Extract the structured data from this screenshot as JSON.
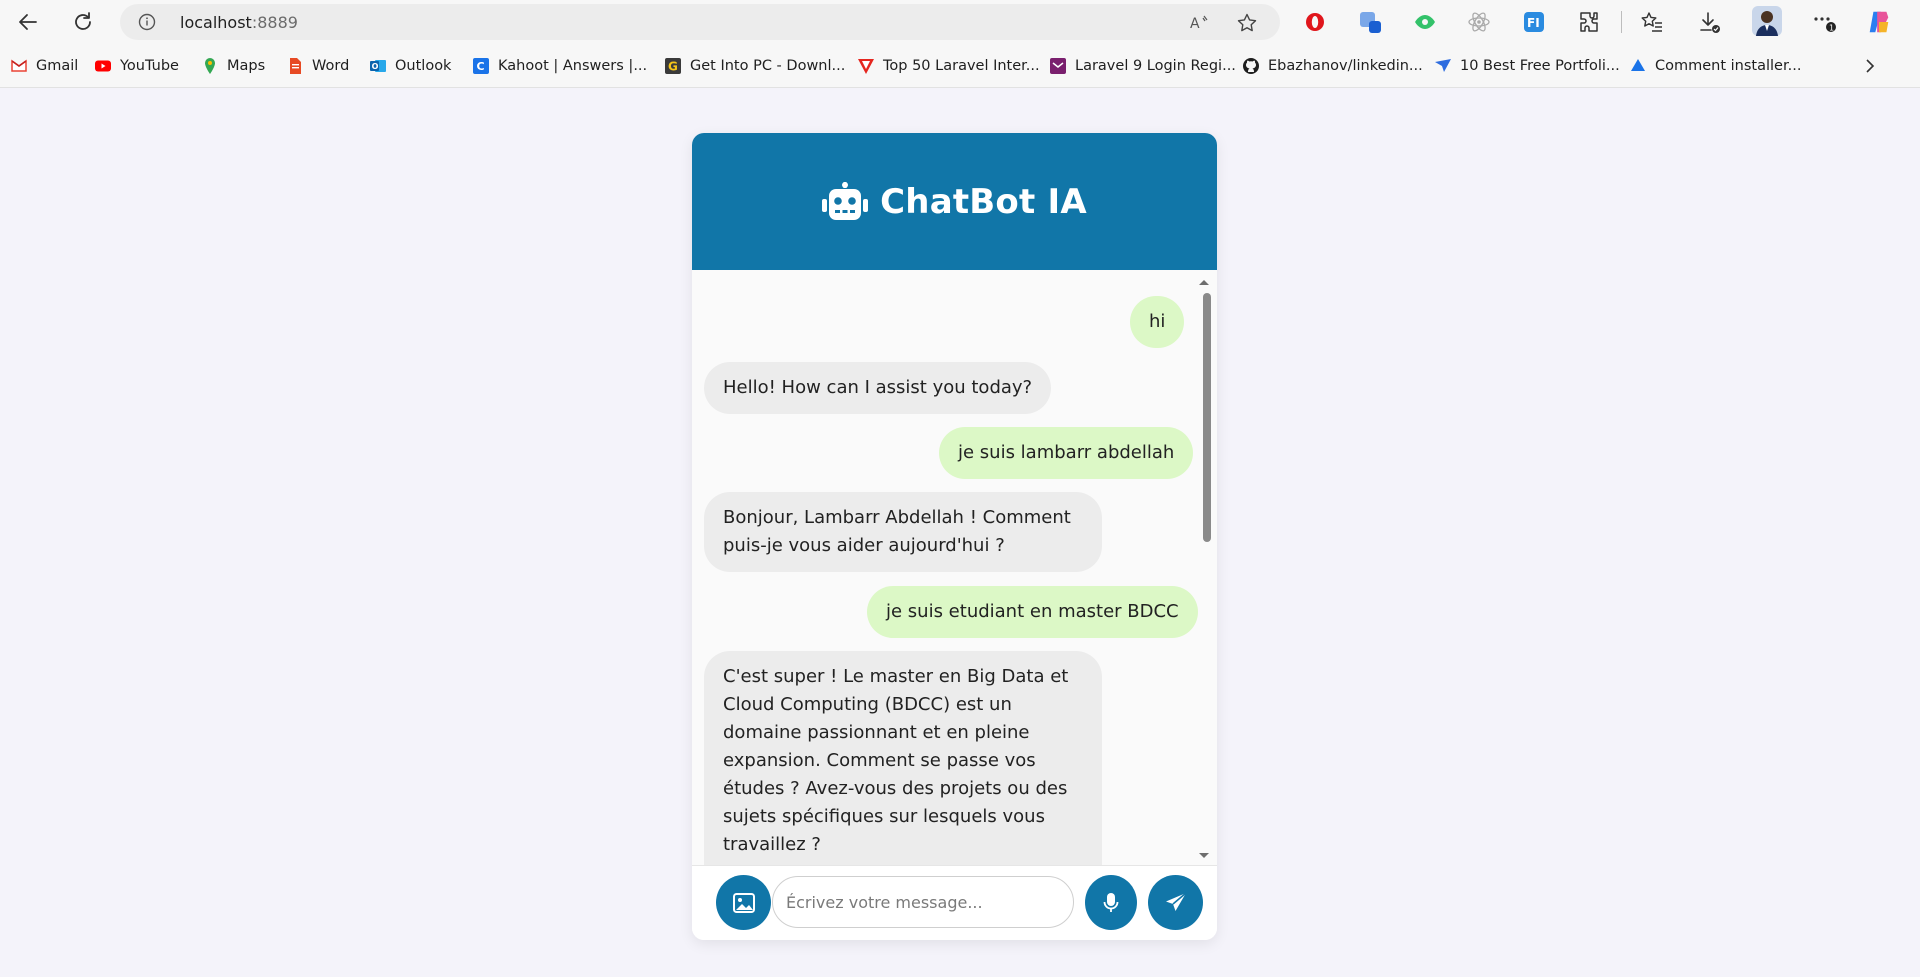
{
  "browser": {
    "url_host": "localhost",
    "url_port": ":8889",
    "bookmarks": [
      {
        "label": "Gmail",
        "icon": "gmail-icon"
      },
      {
        "label": "YouTube",
        "icon": "youtube-icon"
      },
      {
        "label": "Maps",
        "icon": "maps-icon"
      },
      {
        "label": "Word",
        "icon": "word-icon"
      },
      {
        "label": "Outlook",
        "icon": "outlook-icon"
      },
      {
        "label": "Kahoot | Answers |...",
        "icon": "kahoot-icon"
      },
      {
        "label": "Get Into PC - Downl...",
        "icon": "getintopc-icon"
      },
      {
        "label": "Top 50 Laravel Inter...",
        "icon": "laravel-icon"
      },
      {
        "label": "Laravel 9 Login Regi...",
        "icon": "laravel-login-icon"
      },
      {
        "label": "Ebazhanov/linkedin...",
        "icon": "github-icon"
      },
      {
        "label": "10 Best Free Portfoli...",
        "icon": "portfolio-icon"
      },
      {
        "label": "Comment installer...",
        "icon": "drive-icon"
      }
    ]
  },
  "chat": {
    "title": "ChatBot IA",
    "input_placeholder": "Écrivez votre message...",
    "messages": [
      {
        "role": "user",
        "text": "hi"
      },
      {
        "role": "bot",
        "text": "Hello! How can I assist you today?"
      },
      {
        "role": "user",
        "text": "je suis lambarr abdellah"
      },
      {
        "role": "bot",
        "text": "Bonjour, Lambarr Abdellah ! Comment puis-je vous aider aujourd'hui ?"
      },
      {
        "role": "user",
        "text": "je suis etudiant en master BDCC"
      },
      {
        "role": "bot",
        "text": "C'est super ! Le master en Big Data et Cloud Computing (BDCC) est un domaine passionnant et en pleine expansion. Comment se passe vos études ? Avez-vous des projets ou des sujets spécifiques sur lesquels vous travaillez ?"
      }
    ]
  },
  "colors": {
    "header": "#1176a8",
    "user_bubble": "#dcf8c6",
    "bot_bubble": "#ececec",
    "page_bg": "#f4f3fa"
  }
}
